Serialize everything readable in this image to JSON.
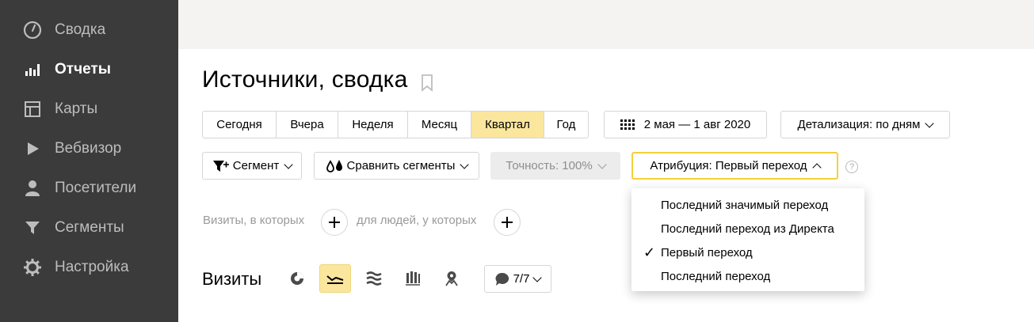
{
  "sidebar": {
    "items": [
      {
        "label": "Сводка",
        "icon": "gauge-icon",
        "active": false
      },
      {
        "label": "Отчеты",
        "icon": "bar-chart-icon",
        "active": true
      },
      {
        "label": "Карты",
        "icon": "map-layout-icon",
        "active": false
      },
      {
        "label": "Вебвизор",
        "icon": "play-icon",
        "active": false
      },
      {
        "label": "Посетители",
        "icon": "person-icon",
        "active": false
      },
      {
        "label": "Сегменты",
        "icon": "funnel-icon",
        "active": false
      },
      {
        "label": "Настройка",
        "icon": "gear-icon",
        "active": false
      }
    ]
  },
  "header": {
    "title": "Источники, сводка"
  },
  "periods": {
    "items": [
      "Сегодня",
      "Вчера",
      "Неделя",
      "Месяц",
      "Квартал",
      "Год"
    ],
    "selected": "Квартал"
  },
  "date_range": "2 мая — 1 авг 2020",
  "detail": "Детализация: по дням",
  "filters": {
    "segment": "Сегмент",
    "compare": "Сравнить сегменты",
    "accuracy": "Точность: 100%",
    "attribution": "Атрибуция: Первый переход",
    "help": "?"
  },
  "segment_builder": {
    "visits_text": "Визиты, в которых",
    "people_text": "для людей, у которых"
  },
  "chart_section": {
    "title": "Визиты",
    "series_count": "7/7"
  },
  "attribution_menu": {
    "items": [
      {
        "label": "Последний значимый переход",
        "checked": false
      },
      {
        "label": "Последний переход из Директа",
        "checked": false
      },
      {
        "label": "Первый переход",
        "checked": true
      },
      {
        "label": "Последний переход",
        "checked": false
      }
    ],
    "check_mark": "✓"
  },
  "colors": {
    "sidebar_bg": "#3b3b3b",
    "selected_yellow": "#fbe69e",
    "focus_yellow": "#f5d03b"
  }
}
